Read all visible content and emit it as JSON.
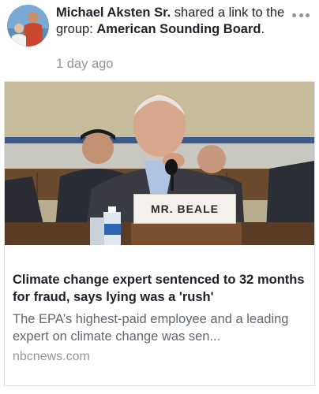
{
  "post": {
    "author": "Michael Aksten Sr.",
    "action": " shared a link to the group: ",
    "group": "American Sounding Board",
    "period": ".",
    "timestamp": "1 day ago"
  },
  "link": {
    "nameplate": "MR. BEALE",
    "title": "Climate change expert sentenced to 32 months for fraud, says lying was a 'rush'",
    "description": "The EPA’s highest-paid employee and a leading expert on climate change was sen...",
    "domain": "nbcnews.com"
  },
  "icons": {
    "more": "more-horizontal-icon"
  },
  "colors": {
    "text_primary": "#1d2129",
    "text_secondary": "#606770",
    "text_meta": "#90949c",
    "card_border": "#dadde1"
  }
}
